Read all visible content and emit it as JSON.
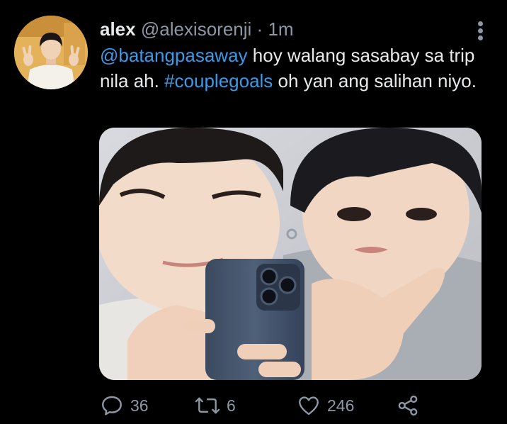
{
  "tweet": {
    "author_name": "alex",
    "author_handle": "@alexisorenji",
    "separator": "·",
    "time": "1m",
    "text_parts": {
      "mention": "@batangpasaway",
      "text_a": " hoy walang sasabay sa trip nila ah. ",
      "hashtag": "#couplegoals",
      "text_b": " oh yan ang salihan niyo."
    }
  },
  "actions": {
    "replies": "36",
    "retweets": "6",
    "likes": "246"
  },
  "icons": {
    "reply": "reply-icon",
    "retweet": "retweet-icon",
    "like": "heart-icon",
    "share": "share-icon",
    "more": "more-vertical-icon"
  },
  "colors": {
    "background": "#000000",
    "text": "#e7e9ea",
    "secondary": "#8b98a5",
    "link": "#3a9ae8"
  }
}
